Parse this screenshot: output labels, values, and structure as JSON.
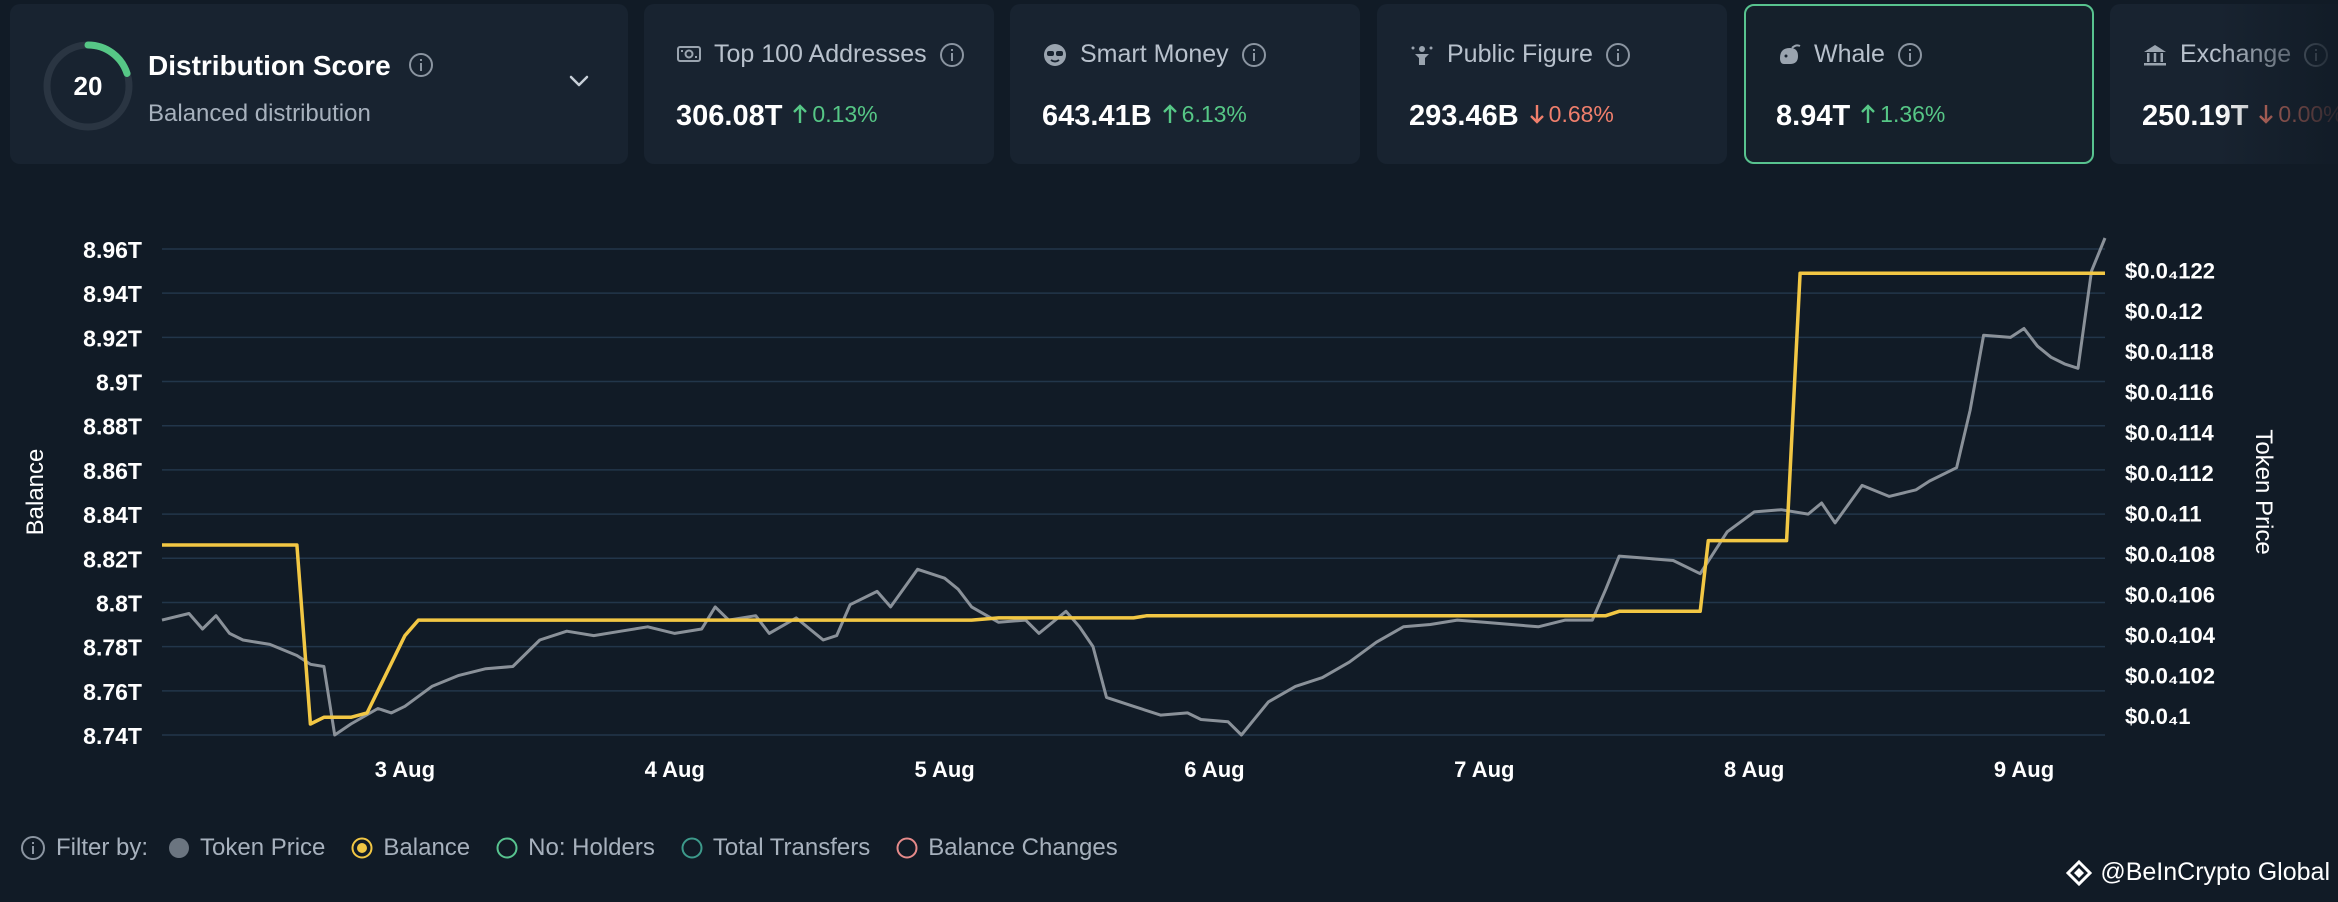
{
  "score": {
    "value": "20",
    "title": "Distribution Score",
    "subtitle": "Balanced distribution",
    "ring_fraction": 0.2,
    "ring_color": "#56c786"
  },
  "metrics": [
    {
      "key": "top100",
      "label": "Top 100 Addresses",
      "icon": "money-icon",
      "value": "306.08T",
      "change": "0.13%",
      "direction": "up"
    },
    {
      "key": "smart",
      "label": "Smart Money",
      "icon": "sunglasses-icon",
      "value": "643.41B",
      "change": "6.13%",
      "direction": "up"
    },
    {
      "key": "public",
      "label": "Public Figure",
      "icon": "figure-icon",
      "value": "293.46B",
      "change": "0.68%",
      "direction": "down"
    },
    {
      "key": "whale",
      "label": "Whale",
      "icon": "whale-icon",
      "value": "8.94T",
      "change": "1.36%",
      "direction": "up",
      "selected": true
    },
    {
      "key": "exchange",
      "label": "Exchange",
      "icon": "bank-icon",
      "value": "250.19T",
      "change": "0.00%",
      "direction": "down"
    }
  ],
  "filter": {
    "label": "Filter by:",
    "items": [
      {
        "name": "Token Price",
        "style": "filled",
        "color": "#6b7580"
      },
      {
        "name": "Balance",
        "style": "ring",
        "color": "#f2c744"
      },
      {
        "name": "No: Holders",
        "style": "outline",
        "color": "#58c38f"
      },
      {
        "name": "Total Transfers",
        "style": "outline",
        "color": "#3d9a8b"
      },
      {
        "name": "Balance Changes",
        "style": "outline",
        "color": "#e58a8a"
      }
    ]
  },
  "watermark": "@BeInCrypto Global",
  "chart_data": {
    "type": "line",
    "xlabel": "",
    "ylabel_left": "Balance",
    "ylabel_right": "Token Price",
    "x_range": [
      2.1,
      9.3
    ],
    "x_ticks": [
      {
        "x": 3,
        "label": "3 Aug"
      },
      {
        "x": 4,
        "label": "4 Aug"
      },
      {
        "x": 5,
        "label": "5 Aug"
      },
      {
        "x": 6,
        "label": "6 Aug"
      },
      {
        "x": 7,
        "label": "7 Aug"
      },
      {
        "x": 8,
        "label": "8 Aug"
      },
      {
        "x": 9,
        "label": "9 Aug"
      }
    ],
    "y_left_range": [
      8.74,
      8.96
    ],
    "y_left_ticks": [
      "8.96T",
      "8.94T",
      "8.92T",
      "8.9T",
      "8.88T",
      "8.86T",
      "8.84T",
      "8.82T",
      "8.8T",
      "8.78T",
      "8.76T",
      "8.74T"
    ],
    "y_right_range": [
      0.1,
      0.122
    ],
    "y_right_ticks": [
      "$0.0₄122",
      "$0.0₄12",
      "$0.0₄118",
      "$0.0₄116",
      "$0.0₄114",
      "$0.0₄112",
      "$0.0₄11",
      "$0.0₄108",
      "$0.0₄106",
      "$0.0₄104",
      "$0.0₄102",
      "$0.0₄1"
    ],
    "grid": true,
    "series": [
      {
        "name": "Balance",
        "axis": "left",
        "color": "#f2c744",
        "step": true,
        "points": [
          [
            2.1,
            8.826
          ],
          [
            2.6,
            8.826
          ],
          [
            2.65,
            8.745
          ],
          [
            2.7,
            8.748
          ],
          [
            2.8,
            8.748
          ],
          [
            2.86,
            8.75
          ],
          [
            2.92,
            8.765
          ],
          [
            3.0,
            8.785
          ],
          [
            3.05,
            8.792
          ],
          [
            5.1,
            8.792
          ],
          [
            5.2,
            8.793
          ],
          [
            5.7,
            8.793
          ],
          [
            5.75,
            8.794
          ],
          [
            7.45,
            8.794
          ],
          [
            7.5,
            8.796
          ],
          [
            7.8,
            8.796
          ],
          [
            7.83,
            8.828
          ],
          [
            8.12,
            8.828
          ],
          [
            8.17,
            8.949
          ],
          [
            9.3,
            8.949
          ]
        ]
      },
      {
        "name": "Token Price",
        "axis": "right",
        "color": "#8a9199",
        "step": false,
        "points": [
          [
            2.1,
            0.1052
          ],
          [
            2.2,
            0.1055
          ],
          [
            2.25,
            0.1048
          ],
          [
            2.3,
            0.1054
          ],
          [
            2.35,
            0.1046
          ],
          [
            2.4,
            0.1043
          ],
          [
            2.5,
            0.1041
          ],
          [
            2.6,
            0.1036
          ],
          [
            2.65,
            0.1032
          ],
          [
            2.7,
            0.1031
          ],
          [
            2.74,
            0.1
          ],
          [
            2.8,
            0.1005
          ],
          [
            2.9,
            0.1012
          ],
          [
            2.95,
            0.101
          ],
          [
            3.0,
            0.1013
          ],
          [
            3.1,
            0.1022
          ],
          [
            3.2,
            0.1027
          ],
          [
            3.3,
            0.103
          ],
          [
            3.4,
            0.1031
          ],
          [
            3.5,
            0.1043
          ],
          [
            3.6,
            0.1047
          ],
          [
            3.7,
            0.1045
          ],
          [
            3.8,
            0.1047
          ],
          [
            3.9,
            0.1049
          ],
          [
            4.0,
            0.1046
          ],
          [
            4.1,
            0.1048
          ],
          [
            4.15,
            0.1058
          ],
          [
            4.2,
            0.1052
          ],
          [
            4.3,
            0.1054
          ],
          [
            4.35,
            0.1046
          ],
          [
            4.45,
            0.1053
          ],
          [
            4.55,
            0.1043
          ],
          [
            4.6,
            0.1045
          ],
          [
            4.65,
            0.1059
          ],
          [
            4.75,
            0.1065
          ],
          [
            4.8,
            0.1058
          ],
          [
            4.9,
            0.1075
          ],
          [
            5.0,
            0.1071
          ],
          [
            5.05,
            0.1066
          ],
          [
            5.1,
            0.1058
          ],
          [
            5.2,
            0.1051
          ],
          [
            5.3,
            0.1052
          ],
          [
            5.35,
            0.1046
          ],
          [
            5.45,
            0.1056
          ],
          [
            5.5,
            0.1049
          ],
          [
            5.55,
            0.104
          ],
          [
            5.6,
            0.1017
          ],
          [
            5.7,
            0.1013
          ],
          [
            5.8,
            0.1009
          ],
          [
            5.9,
            0.101
          ],
          [
            5.95,
            0.1007
          ],
          [
            6.05,
            0.1006
          ],
          [
            6.1,
            0.1
          ],
          [
            6.2,
            0.1015
          ],
          [
            6.3,
            0.1022
          ],
          [
            6.4,
            0.1026
          ],
          [
            6.5,
            0.1033
          ],
          [
            6.6,
            0.1042
          ],
          [
            6.7,
            0.1049
          ],
          [
            6.8,
            0.105
          ],
          [
            6.9,
            0.1052
          ],
          [
            7.0,
            0.1051
          ],
          [
            7.1,
            0.105
          ],
          [
            7.2,
            0.1049
          ],
          [
            7.3,
            0.1052
          ],
          [
            7.4,
            0.1052
          ],
          [
            7.45,
            0.1066
          ],
          [
            7.5,
            0.1081
          ],
          [
            7.6,
            0.108
          ],
          [
            7.7,
            0.1079
          ],
          [
            7.8,
            0.1073
          ],
          [
            7.9,
            0.1092
          ],
          [
            8.0,
            0.1101
          ],
          [
            8.1,
            0.1102
          ],
          [
            8.2,
            0.11
          ],
          [
            8.25,
            0.1105
          ],
          [
            8.3,
            0.1096
          ],
          [
            8.4,
            0.1113
          ],
          [
            8.5,
            0.1108
          ],
          [
            8.6,
            0.1111
          ],
          [
            8.65,
            0.1115
          ],
          [
            8.75,
            0.1121
          ],
          [
            8.8,
            0.1147
          ],
          [
            8.85,
            0.1181
          ],
          [
            8.95,
            0.118
          ],
          [
            9.0,
            0.1184
          ],
          [
            9.05,
            0.1176
          ],
          [
            9.1,
            0.1171
          ],
          [
            9.15,
            0.1168
          ],
          [
            9.2,
            0.1166
          ],
          [
            9.25,
            0.121
          ],
          [
            9.3,
            0.1225
          ]
        ]
      }
    ]
  }
}
